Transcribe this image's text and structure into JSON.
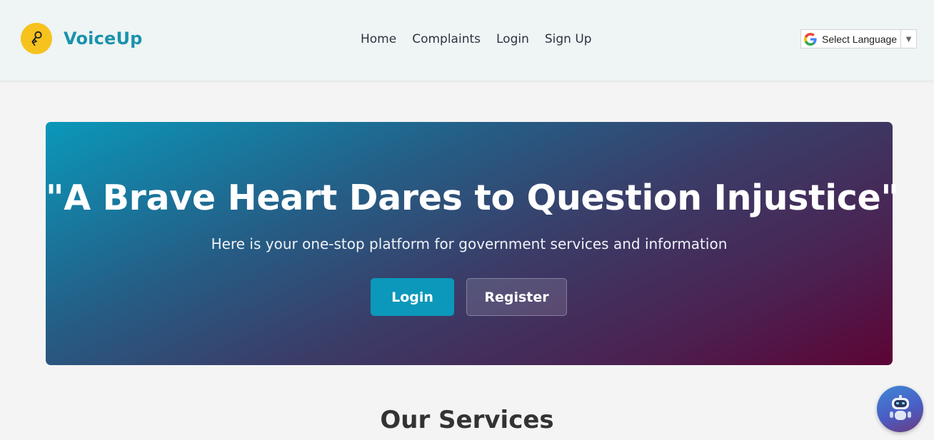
{
  "brand": {
    "name": "VoiceUp",
    "logo_icon": "microphone-lightning-icon",
    "logo_color": "#f6c21d",
    "name_color": "#1a93ad"
  },
  "nav": {
    "items": [
      {
        "label": "Home"
      },
      {
        "label": "Complaints"
      },
      {
        "label": "Login"
      },
      {
        "label": "Sign Up"
      }
    ]
  },
  "language_selector": {
    "label": "Select Language",
    "icon": "google-icon",
    "arrow": "▼"
  },
  "hero": {
    "title": "\"A Brave Heart Dares to Question Injustice\"",
    "subtitle": "Here is your one-stop platform for government services and information",
    "login_label": "Login",
    "register_label": "Register",
    "gradient_start": "#0a98ba",
    "gradient_end": "#5c0435",
    "accent": "#0b98ba"
  },
  "services": {
    "title": "Our Services"
  },
  "chatbot": {
    "icon": "robot-icon"
  }
}
